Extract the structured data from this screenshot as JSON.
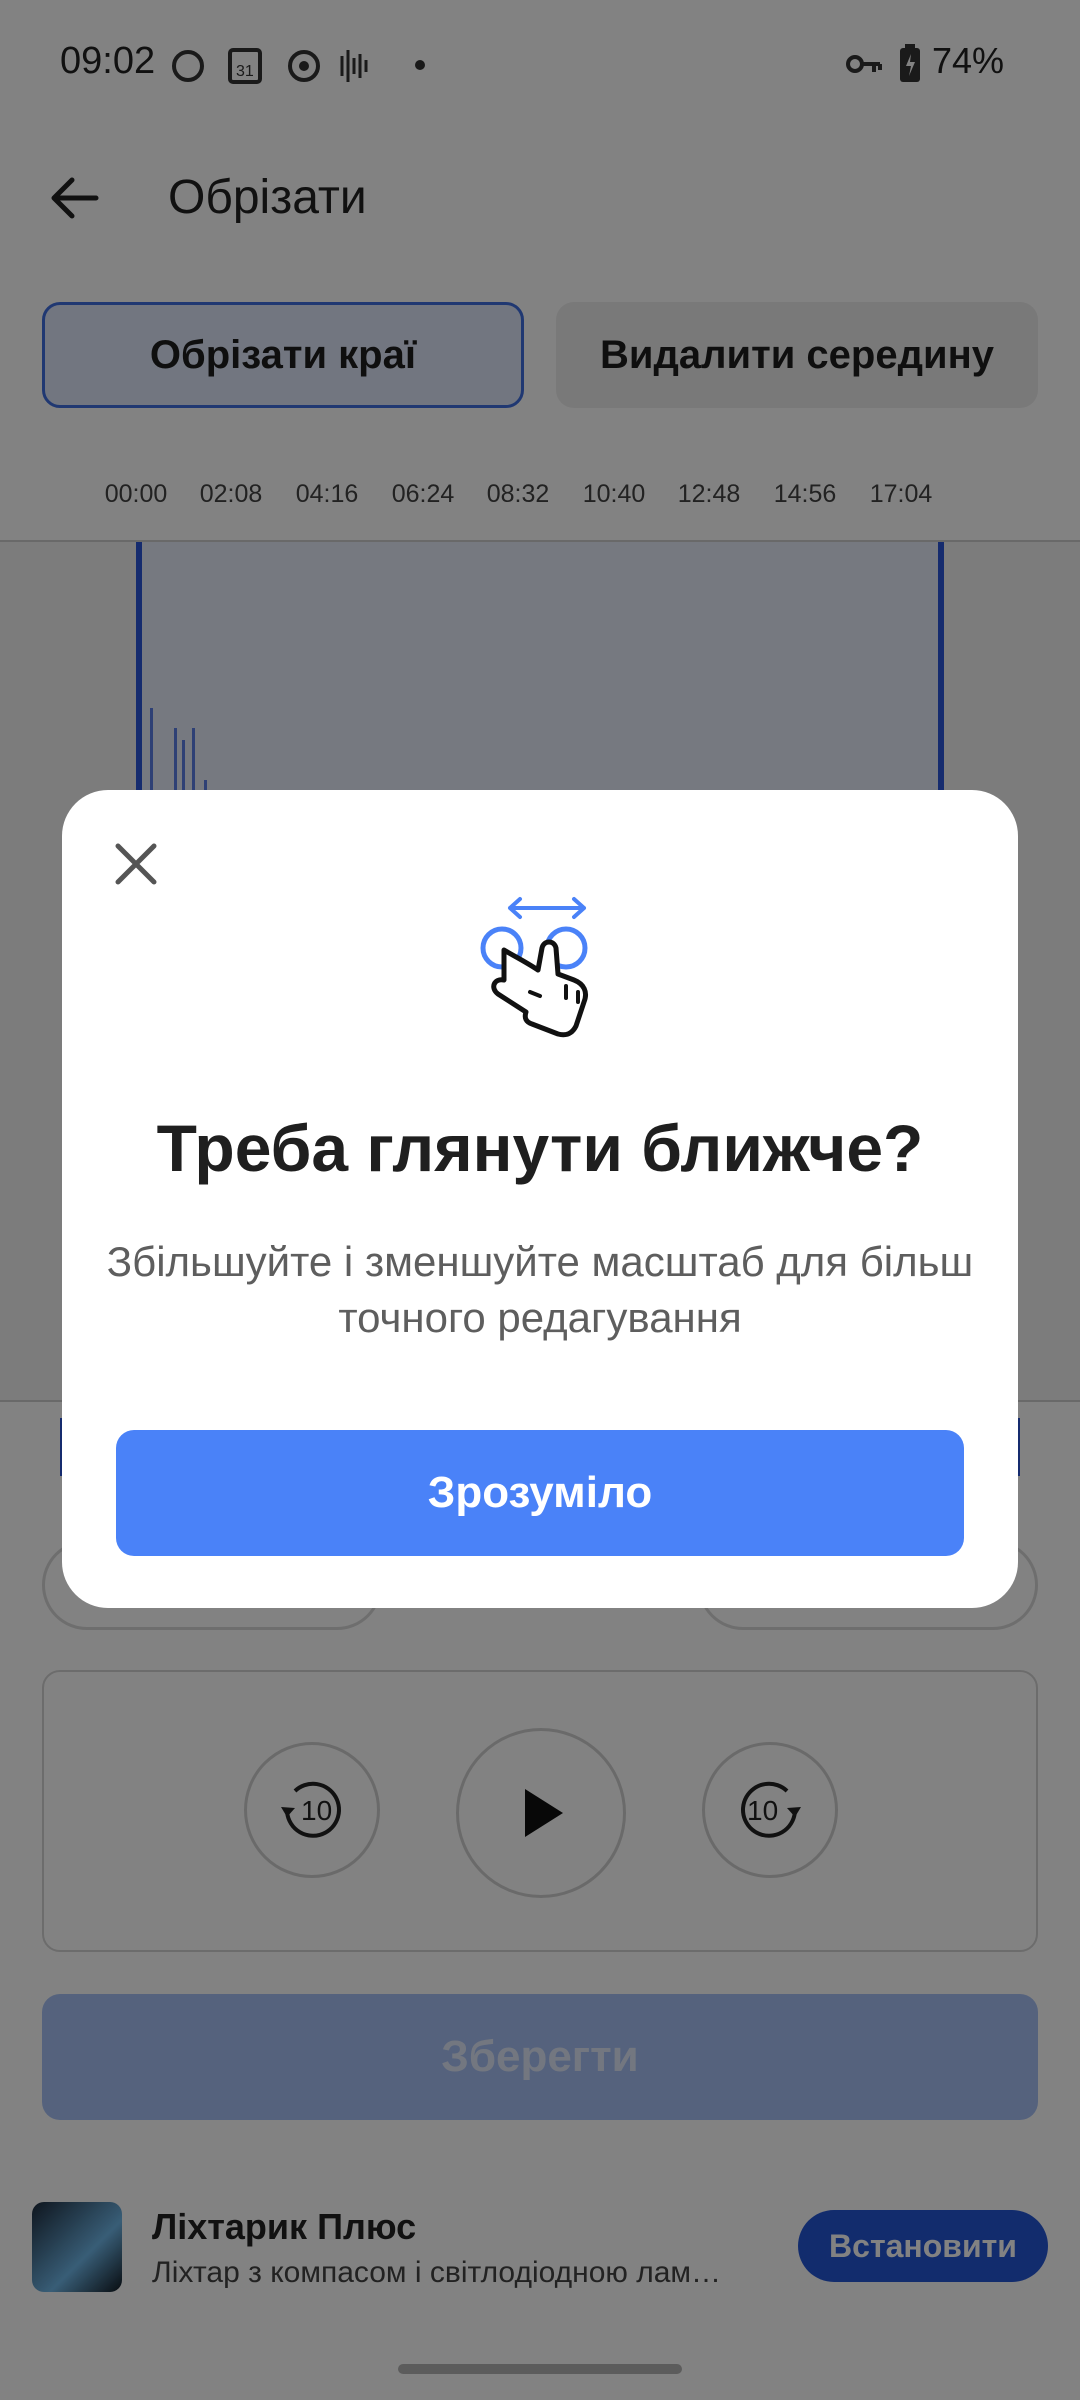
{
  "status_bar": {
    "time": "09:02",
    "battery": "74%",
    "calendar_day": "31"
  },
  "toolbar": {
    "title": "Обрізати"
  },
  "modes": {
    "trim_edges": "Обрізати краї",
    "delete_middle": "Видалити середину"
  },
  "timeline": {
    "ticks": [
      "00:00",
      "02:08",
      "04:16",
      "06:24",
      "08:32",
      "10:40",
      "12:48",
      "14:56",
      "17:04"
    ]
  },
  "player": {
    "rewind_label": "10",
    "forward_label": "10"
  },
  "save_button": "Зберегти",
  "ad": {
    "title": "Ліхтарик Плюс",
    "subtitle": "Ліхтар з компасом і світлодіодною лам…",
    "install": "Встановити"
  },
  "dialog": {
    "title": "Треба глянути ближче?",
    "body": "Збільшуйте і зменшуйте масштаб для більш точного редагування",
    "confirm": "Зрозуміло"
  },
  "colors": {
    "accent": "#4a82f8",
    "selection": "#2a55d8",
    "save_disabled": "#a7c1f5"
  },
  "icons": [
    "back-arrow-icon",
    "close-icon",
    "pinch-zoom-icon",
    "rewind-10-icon",
    "play-icon",
    "forward-10-icon"
  ]
}
